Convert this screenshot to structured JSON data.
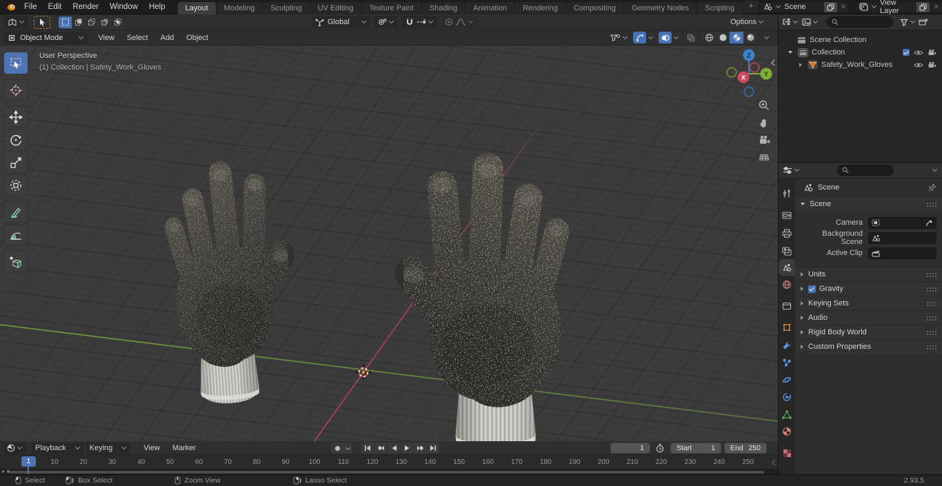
{
  "topbar": {
    "menus": [
      "File",
      "Edit",
      "Render",
      "Window",
      "Help"
    ],
    "tabs": [
      {
        "label": "Layout",
        "active": true
      },
      {
        "label": "Modeling"
      },
      {
        "label": "Sculpting"
      },
      {
        "label": "UV Editing"
      },
      {
        "label": "Texture Paint"
      },
      {
        "label": "Shading"
      },
      {
        "label": "Animation"
      },
      {
        "label": "Rendering"
      },
      {
        "label": "Compositing"
      },
      {
        "label": "Geometry Nodes"
      },
      {
        "label": "Scripting"
      }
    ],
    "add_tab": "+",
    "scene": {
      "value": "Scene"
    },
    "view_layer": {
      "value": "View Layer"
    }
  },
  "icons": {
    "close": "✕"
  },
  "tool_settings": {
    "orientation": "Global",
    "options": "Options"
  },
  "viewport_header": {
    "mode": "Object Mode",
    "menus": [
      "View",
      "Select",
      "Add",
      "Object"
    ]
  },
  "viewport": {
    "view_label": "User Perspective",
    "context_label": "(1) Collection | Safety_Work_Gloves",
    "axis_labels": {
      "x": "X",
      "y": "Y",
      "z": "Z"
    },
    "colors": {
      "background": "#3c3c3c",
      "axis_x": "#c04552",
      "axis_y": "#7aa83c",
      "accent": "#4772b3"
    }
  },
  "outliner": {
    "rows": [
      {
        "label": "Scene Collection"
      },
      {
        "label": "Collection"
      },
      {
        "label": "Safety_Work_Gloves"
      }
    ]
  },
  "properties": {
    "context_label": "Scene",
    "panel": {
      "title": "Scene",
      "fields": [
        {
          "label": "Camera"
        },
        {
          "label": "Background Scene"
        },
        {
          "label": "Active Clip"
        }
      ]
    },
    "sections": [
      {
        "label": "Units"
      },
      {
        "label": "Gravity",
        "checked": true
      },
      {
        "label": "Keying Sets"
      },
      {
        "label": "Audio"
      },
      {
        "label": "Rigid Body World"
      },
      {
        "label": "Custom Properties"
      }
    ]
  },
  "timeline": {
    "menus": [
      "Playback",
      "Keying",
      "View",
      "Marker"
    ],
    "current_frame": "1",
    "frame_field": "1",
    "start": {
      "label": "Start",
      "value": "1"
    },
    "end": {
      "label": "End",
      "value": "250"
    },
    "ruler": [
      "10",
      "20",
      "30",
      "40",
      "50",
      "60",
      "70",
      "80",
      "90",
      "100",
      "110",
      "120",
      "130",
      "140",
      "150",
      "160",
      "170",
      "180",
      "190",
      "200",
      "210",
      "220",
      "230",
      "240",
      "250"
    ]
  },
  "statusbar": {
    "items": [
      {
        "label": "Select"
      },
      {
        "label": "Box Select"
      },
      {
        "label": "Zoom View"
      },
      {
        "label": "Lasso Select"
      }
    ],
    "version": "2.93.5"
  }
}
